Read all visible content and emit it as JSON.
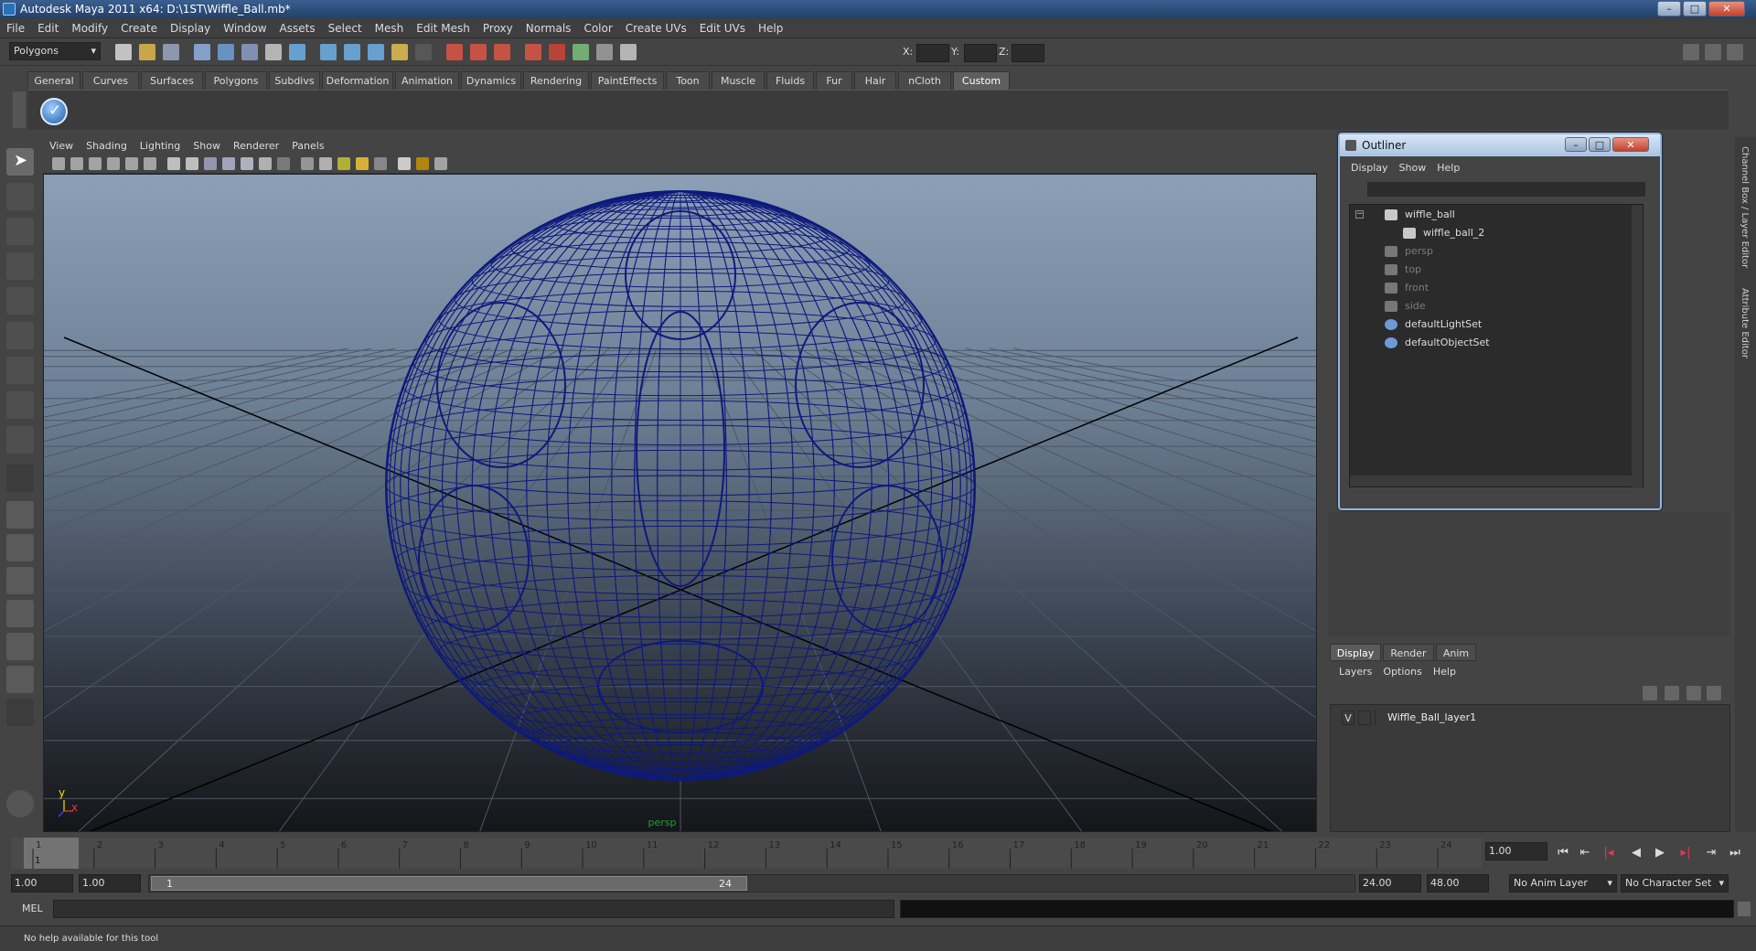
{
  "window": {
    "title": "Autodesk Maya 2011 x64: D:\\1ST\\Wiffle_Ball.mb*"
  },
  "menubar": [
    "File",
    "Edit",
    "Modify",
    "Create",
    "Display",
    "Window",
    "Assets",
    "Select",
    "Mesh",
    "Edit Mesh",
    "Proxy",
    "Normals",
    "Color",
    "Create UVs",
    "Edit UVs",
    "Help"
  ],
  "statusline": {
    "mode": "Polygons",
    "x_label": "X:",
    "y_label": "Y:",
    "z_label": "Z:"
  },
  "shelf_tabs": [
    "General",
    "Curves",
    "Surfaces",
    "Polygons",
    "Subdivs",
    "Deformation",
    "Animation",
    "Dynamics",
    "Rendering",
    "PaintEffects",
    "Toon",
    "Muscle",
    "Fluids",
    "Fur",
    "Hair",
    "nCloth",
    "Custom"
  ],
  "shelf_active": "Custom",
  "viewport": {
    "menu": [
      "View",
      "Shading",
      "Lighting",
      "Show",
      "Renderer",
      "Panels"
    ],
    "camera_label": "persp",
    "axis_y": "y",
    "axis_x": "x"
  },
  "outliner": {
    "title": "Outliner",
    "menu": [
      "Display",
      "Show",
      "Help"
    ],
    "items": [
      {
        "label": "wiffle_ball",
        "dim": false,
        "indent": 0
      },
      {
        "label": "wiffle_ball_2",
        "dim": false,
        "indent": 1
      },
      {
        "label": "persp",
        "dim": true,
        "indent": 0
      },
      {
        "label": "top",
        "dim": true,
        "indent": 0
      },
      {
        "label": "front",
        "dim": true,
        "indent": 0
      },
      {
        "label": "side",
        "dim": true,
        "indent": 0
      },
      {
        "label": "defaultLightSet",
        "dim": false,
        "indent": 0
      },
      {
        "label": "defaultObjectSet",
        "dim": false,
        "indent": 0
      }
    ]
  },
  "layer_editor": {
    "tabs": [
      "Display",
      "Render",
      "Anim"
    ],
    "menu": [
      "Layers",
      "Options",
      "Help"
    ],
    "layer_visibility": "V",
    "layer_name": "Wiffle_Ball_layer1"
  },
  "side_tabs": {
    "channel_box": "Channel Box / Layer Editor",
    "attribute_editor": "Attribute Editor"
  },
  "timeline": {
    "ticks": [
      "1",
      "2",
      "3",
      "4",
      "5",
      "6",
      "7",
      "8",
      "9",
      "10",
      "11",
      "12",
      "13",
      "14",
      "15",
      "16",
      "17",
      "18",
      "19",
      "20",
      "21",
      "22",
      "23",
      "24"
    ],
    "current_frame_marker": "1",
    "current_time": "1.00"
  },
  "range": {
    "start": "1.00",
    "playback_start": "1.00",
    "slider_start": "1",
    "slider_end": "24",
    "playback_end": "24.00",
    "end": "48.00",
    "anim_layer": "No Anim Layer",
    "character_set": "No Character Set"
  },
  "cmdline": {
    "label": "MEL"
  },
  "helpline": {
    "text": "No help available for this tool"
  }
}
